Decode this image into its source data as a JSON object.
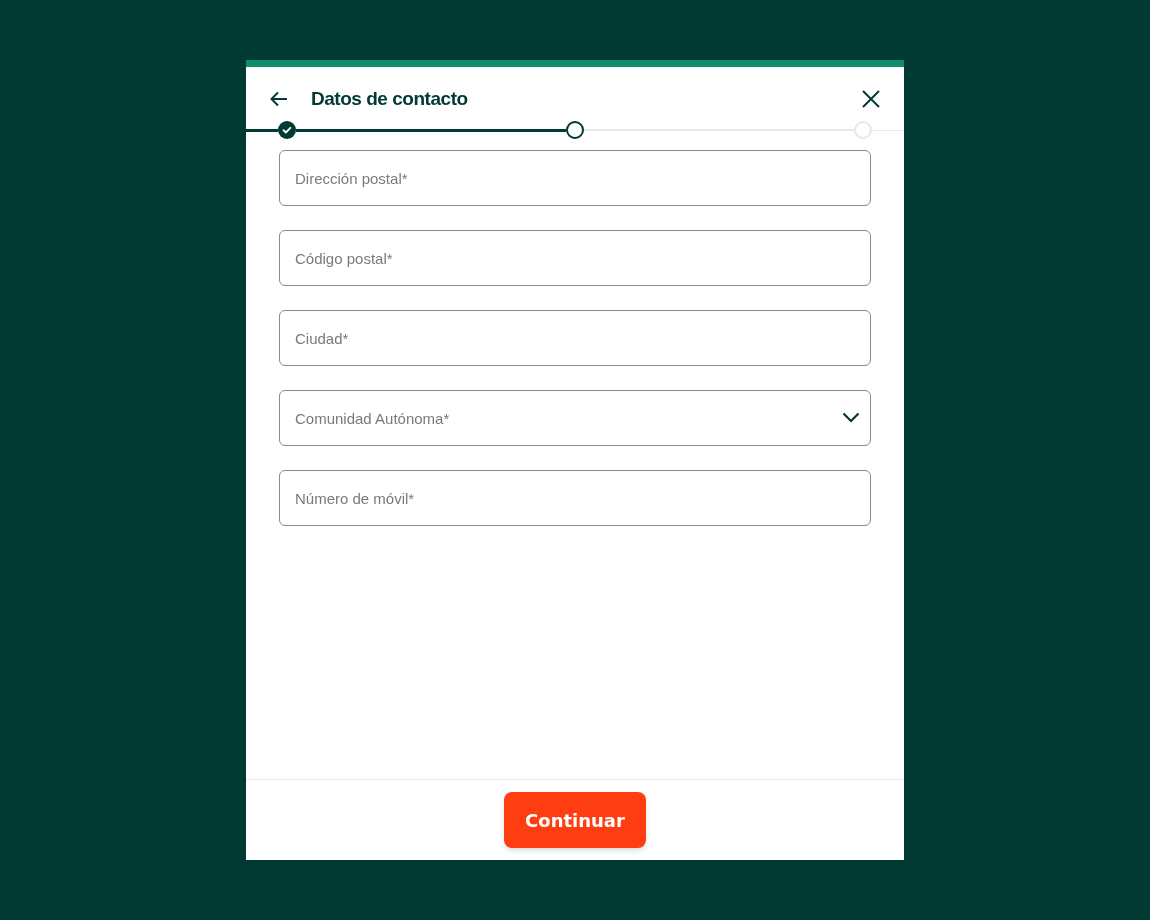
{
  "dialog": {
    "title": "Datos de contacto"
  },
  "steps": [
    {
      "completed": true,
      "selected": false
    },
    {
      "completed": false,
      "selected": true
    },
    {
      "completed": false,
      "selected": false
    }
  ],
  "fields": [
    {
      "kind": "text",
      "placeholder": "Dirección postal*"
    },
    {
      "kind": "text",
      "placeholder": "Código postal*"
    },
    {
      "kind": "text",
      "placeholder": "Ciudad*"
    },
    {
      "kind": "select",
      "placeholder": "Comunidad Autónoma*"
    },
    {
      "kind": "text",
      "placeholder": "Número de móvil*"
    }
  ],
  "footer": {
    "button": "Continuar"
  }
}
